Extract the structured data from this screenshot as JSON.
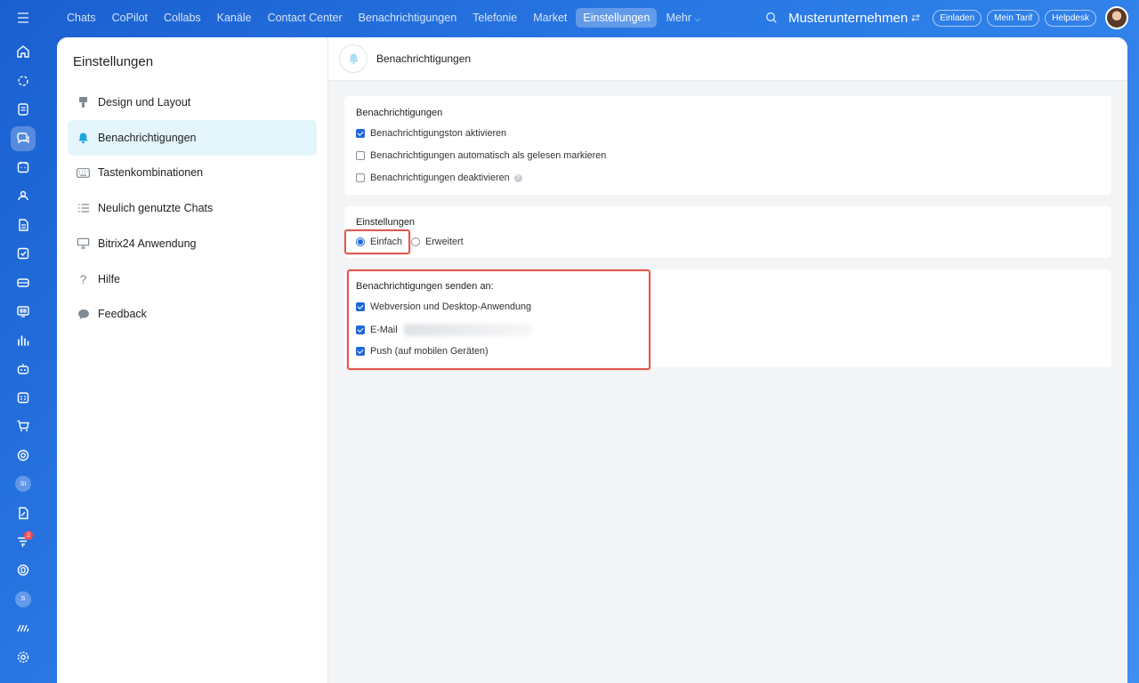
{
  "rail": {
    "icons": [
      "menu-icon",
      "home-icon",
      "copilot-icon",
      "feed-icon",
      "chats-icon",
      "calendar-icon",
      "contacts-icon",
      "documents-icon",
      "tasks-icon",
      "crm-icon",
      "sites-icon",
      "analytics-icon",
      "robot-icon",
      "schedule-icon",
      "shop-icon",
      "goals-icon",
      "avatar-si",
      "sign-icon",
      "automation-icon",
      "support-icon",
      "avatar-s",
      "bitrix-icon",
      "settings-icon"
    ],
    "si_label": "SI",
    "s_label": "S",
    "badge_count": "2"
  },
  "topnav": {
    "items": [
      "Chats",
      "CoPilot",
      "Collabs",
      "Kanäle",
      "Contact Center",
      "Benachrichtigungen",
      "Telefonie",
      "Market",
      "Einstellungen",
      "Mehr"
    ],
    "active_index": 8,
    "company": "Musterunternehmen",
    "buttons": [
      "Einladen",
      "Mein Tarif",
      "Helpdesk"
    ]
  },
  "sidebar": {
    "title": "Einstellungen",
    "items": [
      {
        "label": "Design und Layout",
        "icon": "brush-icon"
      },
      {
        "label": "Benachrichtigungen",
        "icon": "bell-icon"
      },
      {
        "label": "Tastenkombinationen",
        "icon": "keyboard-icon"
      },
      {
        "label": "Neulich genutzte Chats",
        "icon": "list-icon"
      },
      {
        "label": "Bitrix24 Anwendung",
        "icon": "monitor-icon"
      },
      {
        "label": "Hilfe",
        "icon": "question-icon"
      },
      {
        "label": "Feedback",
        "icon": "chat-bubble-icon"
      }
    ],
    "active_index": 1
  },
  "content": {
    "header_title": "Benachrichtigungen",
    "notifications": {
      "title": "Benachrichtigungen",
      "options": [
        {
          "label": "Benachrichtigungston aktivieren",
          "checked": true
        },
        {
          "label": "Benachrichtigungen automatisch als gelesen markieren",
          "checked": false
        },
        {
          "label": "Benachrichtigungen deaktivieren",
          "checked": false
        }
      ]
    },
    "settings": {
      "title": "Einstellungen",
      "options": [
        {
          "label": "Einfach",
          "checked": true
        },
        {
          "label": "Erweitert",
          "checked": false
        }
      ]
    },
    "send_to": {
      "title": "Benachrichtigungen senden an:",
      "options": [
        {
          "label": "Webversion und Desktop-Anwendung",
          "checked": true
        },
        {
          "label": "E-Mail",
          "checked": true
        },
        {
          "label": "Push (auf mobilen Geräten)",
          "checked": true
        }
      ]
    }
  },
  "colors": {
    "accent": "#2067d8",
    "highlight": "#e05a4f",
    "active_menu_bg": "#e4f6fc"
  }
}
